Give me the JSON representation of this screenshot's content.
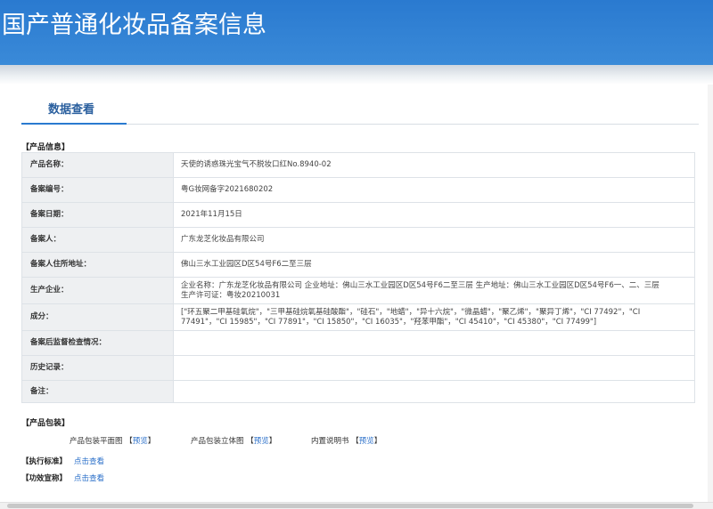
{
  "header": {
    "title": "国产普通化妆品备案信息"
  },
  "tabs": [
    {
      "label": "数据查看",
      "active": true
    }
  ],
  "product_info": {
    "section_title": "【产品信息】",
    "rows": [
      {
        "label": "产品名称：",
        "value": "天使的诱惑珠光宝气不脱妆口红No.8940-02"
      },
      {
        "label": "备案编号：",
        "value": "粤G妆网备字2021680202"
      },
      {
        "label": "备案日期：",
        "value": "2021年11月15日"
      },
      {
        "label": "备案人：",
        "value": "广东龙芝化妆品有限公司"
      },
      {
        "label": "备案人住所地址：",
        "value": "佛山三水工业园区D区54号F6二至三层"
      },
      {
        "label": "生产企业：",
        "value": "企业名称：广东龙芝化妆品有限公司 企业地址：佛山三水工业园区D区54号F6二至三层 生产地址：佛山三水工业园区D区54号F6一、二、三层 生产许可证：粤妆20210031"
      },
      {
        "label": "成分：",
        "value": "[\"环五聚二甲基硅氧烷\"，\"三甲基硅烷氧基硅酸酯\"，\"硅石\"，\"地蜡\"，\"异十六烷\"，\"微晶蜡\"，\"聚乙烯\"，\"聚异丁烯\"，\"CI 77492\"，\"CI 77491\"，\"CI 15985\"，\"CI 77891\"，\"CI 15850\"，\"CI 16035\"，\"羟苯甲酯\"，\"CI 45410\"，\"CI 45380\"，\"CI 77499\"]"
      },
      {
        "label": "备案后监督检查情况：",
        "value": ""
      },
      {
        "label": "历史记录：",
        "value": ""
      },
      {
        "label": "备注：",
        "value": ""
      }
    ]
  },
  "packaging": {
    "section_title": "【产品包装】",
    "items": [
      {
        "label": "产品包装平面图",
        "link": "预览"
      },
      {
        "label": "产品包装立体图",
        "link": "预览"
      },
      {
        "label": "内置说明书",
        "link": "预览"
      }
    ]
  },
  "standard": {
    "label": "【执行标准】",
    "link": "点击查看"
  },
  "claims": {
    "label": "【功效宣称】",
    "link": "点击查看"
  },
  "colors": {
    "header": "#2a7ad0",
    "link": "#2a6fc9",
    "label_bg": "#eef0f2"
  }
}
